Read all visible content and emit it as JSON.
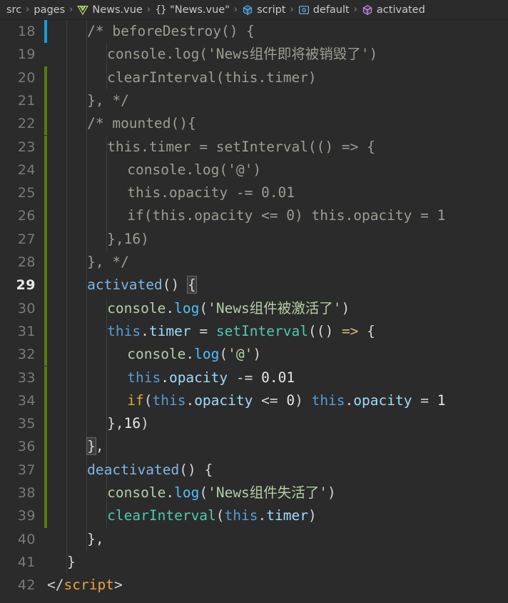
{
  "window": {
    "app": "Visual Studio Code",
    "theme_background": "#2b2b2b",
    "active_line_background": "#333333"
  },
  "breadcrumb": {
    "separator": "›",
    "items": [
      {
        "label": "src",
        "icon": null
      },
      {
        "label": "pages",
        "icon": null
      },
      {
        "label": "News.vue",
        "icon": "vue-file-icon"
      },
      {
        "label": "\"News.vue\"",
        "icon": "braces-icon"
      },
      {
        "label": "script",
        "icon": "cube-blue-icon"
      },
      {
        "label": "default",
        "icon": "variable-blue-icon"
      },
      {
        "label": "activated",
        "icon": "cube-purple-icon"
      }
    ]
  },
  "editor": {
    "language": "vue",
    "active_line_number": 29,
    "cursor_gutter_line": 18,
    "git_added_from_line": 20,
    "git_added_to_line": 39,
    "indent_guide_columns": [
      1,
      2,
      3,
      4
    ],
    "lines": [
      {
        "n": 18,
        "indent": 1,
        "gutter": "cursor",
        "tokens": [
          {
            "t": "comment",
            "v": "/* beforeDestroy() {"
          }
        ]
      },
      {
        "n": 19,
        "indent": 2,
        "gutter": "none",
        "tokens": [
          {
            "t": "comment",
            "v": "console.log('News组件即将被销毁了')"
          }
        ]
      },
      {
        "n": 20,
        "indent": 2,
        "gutter": "added",
        "tokens": [
          {
            "t": "comment",
            "v": "clearInterval(this.timer)"
          }
        ]
      },
      {
        "n": 21,
        "indent": 1,
        "gutter": "added",
        "tokens": [
          {
            "t": "comment",
            "v": "}, */"
          }
        ]
      },
      {
        "n": 22,
        "indent": 1,
        "gutter": "added",
        "tokens": [
          {
            "t": "comment",
            "v": "/* mounted(){"
          }
        ]
      },
      {
        "n": 23,
        "indent": 2,
        "gutter": "added",
        "tokens": [
          {
            "t": "comment",
            "v": "this.timer = setInterval(() => {"
          }
        ]
      },
      {
        "n": 24,
        "indent": 3,
        "gutter": "added",
        "tokens": [
          {
            "t": "comment",
            "v": "console.log('@')"
          }
        ]
      },
      {
        "n": 25,
        "indent": 3,
        "gutter": "added",
        "tokens": [
          {
            "t": "comment",
            "v": "this.opacity -= 0.01"
          }
        ]
      },
      {
        "n": 26,
        "indent": 3,
        "gutter": "added",
        "tokens": [
          {
            "t": "comment",
            "v": "if(this.opacity <= 0) this.opacity = 1"
          }
        ]
      },
      {
        "n": 27,
        "indent": 2,
        "gutter": "added",
        "tokens": [
          {
            "t": "comment",
            "v": "},16)"
          }
        ]
      },
      {
        "n": 28,
        "indent": 1,
        "gutter": "added",
        "tokens": [
          {
            "t": "comment",
            "v": "}, */"
          }
        ]
      },
      {
        "n": 29,
        "indent": 1,
        "gutter": "added",
        "active": true,
        "tokens": [
          {
            "t": "fname",
            "v": "activated"
          },
          {
            "t": "punc",
            "v": "() "
          },
          {
            "t": "bracket",
            "v": "{"
          }
        ]
      },
      {
        "n": 30,
        "indent": 2,
        "gutter": "added",
        "tokens": [
          {
            "t": "obj",
            "v": "console"
          },
          {
            "t": "punc",
            "v": "."
          },
          {
            "t": "method",
            "v": "log"
          },
          {
            "t": "punc",
            "v": "("
          },
          {
            "t": "str",
            "v": "'News组件被激活了'"
          },
          {
            "t": "punc",
            "v": ")"
          }
        ]
      },
      {
        "n": 31,
        "indent": 2,
        "gutter": "added",
        "tokens": [
          {
            "t": "this",
            "v": "this"
          },
          {
            "t": "punc",
            "v": "."
          },
          {
            "t": "prop",
            "v": "timer"
          },
          {
            "t": "punc",
            "v": " = "
          },
          {
            "t": "fn",
            "v": "setInterval"
          },
          {
            "t": "punc",
            "v": "(() "
          },
          {
            "t": "arrow",
            "v": "=>"
          },
          {
            "t": "punc",
            "v": " {"
          }
        ]
      },
      {
        "n": 32,
        "indent": 3,
        "gutter": "added",
        "tokens": [
          {
            "t": "obj",
            "v": "console"
          },
          {
            "t": "punc",
            "v": "."
          },
          {
            "t": "method",
            "v": "log"
          },
          {
            "t": "punc",
            "v": "("
          },
          {
            "t": "str",
            "v": "'@'"
          },
          {
            "t": "punc",
            "v": ")"
          }
        ]
      },
      {
        "n": 33,
        "indent": 3,
        "gutter": "added",
        "tokens": [
          {
            "t": "this",
            "v": "this"
          },
          {
            "t": "punc",
            "v": "."
          },
          {
            "t": "prop",
            "v": "opacity"
          },
          {
            "t": "punc",
            "v": " -= "
          },
          {
            "t": "num",
            "v": "0.01"
          }
        ]
      },
      {
        "n": 34,
        "indent": 3,
        "gutter": "added",
        "tokens": [
          {
            "t": "if",
            "v": "if"
          },
          {
            "t": "punc",
            "v": "("
          },
          {
            "t": "this",
            "v": "this"
          },
          {
            "t": "punc",
            "v": "."
          },
          {
            "t": "prop",
            "v": "opacity"
          },
          {
            "t": "punc",
            "v": " <= "
          },
          {
            "t": "num",
            "v": "0"
          },
          {
            "t": "punc",
            "v": ") "
          },
          {
            "t": "this",
            "v": "this"
          },
          {
            "t": "punc",
            "v": "."
          },
          {
            "t": "prop",
            "v": "opacity"
          },
          {
            "t": "punc",
            "v": " = "
          },
          {
            "t": "num",
            "v": "1"
          }
        ]
      },
      {
        "n": 35,
        "indent": 2,
        "gutter": "added",
        "tokens": [
          {
            "t": "punc",
            "v": "},"
          },
          {
            "t": "num",
            "v": "16"
          },
          {
            "t": "punc",
            "v": ")"
          }
        ]
      },
      {
        "n": 36,
        "indent": 1,
        "gutter": "added",
        "tokens": [
          {
            "t": "bracket",
            "v": "}"
          },
          {
            "t": "punc",
            "v": ","
          }
        ]
      },
      {
        "n": 37,
        "indent": 1,
        "gutter": "added",
        "tokens": [
          {
            "t": "fname",
            "v": "deactivated"
          },
          {
            "t": "punc",
            "v": "() {"
          }
        ]
      },
      {
        "n": 38,
        "indent": 2,
        "gutter": "added",
        "tokens": [
          {
            "t": "obj",
            "v": "console"
          },
          {
            "t": "punc",
            "v": "."
          },
          {
            "t": "method",
            "v": "log"
          },
          {
            "t": "punc",
            "v": "("
          },
          {
            "t": "str",
            "v": "'News组件失活了'"
          },
          {
            "t": "punc",
            "v": ")"
          }
        ]
      },
      {
        "n": 39,
        "indent": 2,
        "gutter": "added",
        "tokens": [
          {
            "t": "fn",
            "v": "clearInterval"
          },
          {
            "t": "punc",
            "v": "("
          },
          {
            "t": "this",
            "v": "this"
          },
          {
            "t": "punc",
            "v": "."
          },
          {
            "t": "prop",
            "v": "timer"
          },
          {
            "t": "punc",
            "v": ")"
          }
        ]
      },
      {
        "n": 40,
        "indent": 1,
        "gutter": "none",
        "tokens": [
          {
            "t": "punc",
            "v": "},"
          }
        ]
      },
      {
        "n": 41,
        "indent": 0,
        "gutter": "none",
        "tokens": [
          {
            "t": "punc",
            "v": "}"
          }
        ]
      },
      {
        "n": 42,
        "indent": -1,
        "gutter": "none",
        "tokens": [
          {
            "t": "tagb",
            "v": "</"
          },
          {
            "t": "tag",
            "v": "script"
          },
          {
            "t": "tagb",
            "v": ">"
          }
        ]
      }
    ]
  }
}
